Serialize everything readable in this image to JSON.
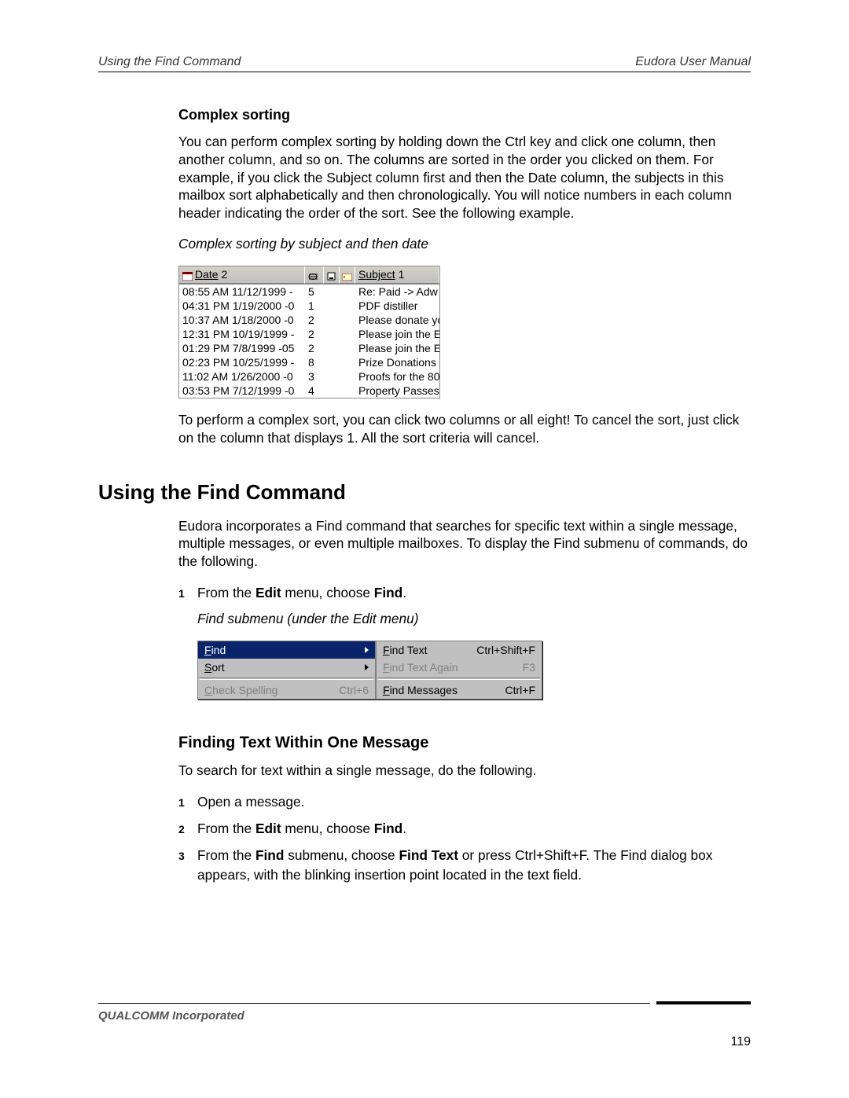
{
  "header": {
    "left": "Using the Find Command",
    "right": "Eudora User Manual"
  },
  "section1": {
    "title": "Complex sorting",
    "para1": "You can perform complex sorting by holding down the Ctrl key and click one column, then another column, and so on. The columns are sorted in the order you clicked on them. For example, if you click the Subject column first and then the Date column, the subjects in this mailbox sort alphabetically and then chronologically. You will notice numbers in each column header indicating the order of the sort. See the following example.",
    "caption": "Complex sorting by subject and then date",
    "table": {
      "headers": {
        "date_label": "Date",
        "date_sort": "2",
        "subject_label": "Subject",
        "subject_sort": "1"
      },
      "rows": [
        {
          "date": "08:55 AM 11/12/1999 -",
          "a": "5",
          "subj": "Re: Paid -> Adw"
        },
        {
          "date": "04:31 PM 1/19/2000 -0",
          "a": "1",
          "subj": "PDF distiller"
        },
        {
          "date": "10:37 AM 1/18/2000 -0",
          "a": "2",
          "subj": "Please donate yo"
        },
        {
          "date": "12:31 PM 10/19/1999 -",
          "a": "2",
          "subj": "Please join the E"
        },
        {
          "date": "01:29 PM 7/8/1999 -05",
          "a": "2",
          "subj": "Please join the E"
        },
        {
          "date": "02:23 PM 10/25/1999 -",
          "a": "8",
          "subj": "Prize Donations"
        },
        {
          "date": "11:02 AM 1/26/2000 -0",
          "a": "3",
          "subj": "Proofs for the 80"
        },
        {
          "date": "03:53 PM 7/12/1999 -0",
          "a": "4",
          "subj": "Property Passes"
        }
      ]
    },
    "para2": "To perform a complex sort, you can click two columns or all eight! To cancel the sort, just click on the column that displays 1. All the sort criteria will cancel."
  },
  "section2": {
    "title": "Using the Find Command",
    "para1": "Eudora incorporates a Find command that searches for specific text within a single message, multiple messages, or even multiple mailboxes. To display the Find submenu of commands, do the following.",
    "step1_pre": "From the ",
    "step1_b1": "Edit",
    "step1_mid": " menu, choose ",
    "step1_b2": "Find",
    "step1_end": ".",
    "caption": "Find submenu (under the Edit menu)",
    "menu_left": [
      {
        "label": "Find",
        "shortcut": "",
        "sel": true,
        "dis": false,
        "arrow": true
      },
      {
        "label": "Sort",
        "shortcut": "",
        "sel": false,
        "dis": false,
        "arrow": true
      },
      {
        "sep": true
      },
      {
        "label": "Check Spelling",
        "shortcut": "Ctrl+6",
        "sel": false,
        "dis": true,
        "arrow": false
      }
    ],
    "menu_right": [
      {
        "label": "Find Text",
        "shortcut": "Ctrl+Shift+F",
        "sel": false,
        "dis": false
      },
      {
        "label": "Find Text Again",
        "shortcut": "F3",
        "sel": false,
        "dis": true
      },
      {
        "sep": true
      },
      {
        "label": "Find Messages",
        "shortcut": "Ctrl+F",
        "sel": false,
        "dis": false
      }
    ]
  },
  "section3": {
    "title": "Finding Text Within One Message",
    "para1": "To search for text within a single message, do the following.",
    "steps": [
      {
        "n": "1",
        "parts": [
          {
            "t": "Open a message."
          }
        ]
      },
      {
        "n": "2",
        "parts": [
          {
            "t": "From the "
          },
          {
            "b": "Edit"
          },
          {
            "t": " menu, choose "
          },
          {
            "b": "Find"
          },
          {
            "t": "."
          }
        ]
      },
      {
        "n": "3",
        "parts": [
          {
            "t": "From the "
          },
          {
            "b": "Find"
          },
          {
            "t": " submenu, choose "
          },
          {
            "b": "Find Text"
          },
          {
            "t": " or press Ctrl+Shift+F. The Find dialog box appears, with the blinking insertion point located in the text field."
          }
        ]
      }
    ]
  },
  "footer": {
    "company": "QUALCOMM Incorporated",
    "page": "119"
  }
}
